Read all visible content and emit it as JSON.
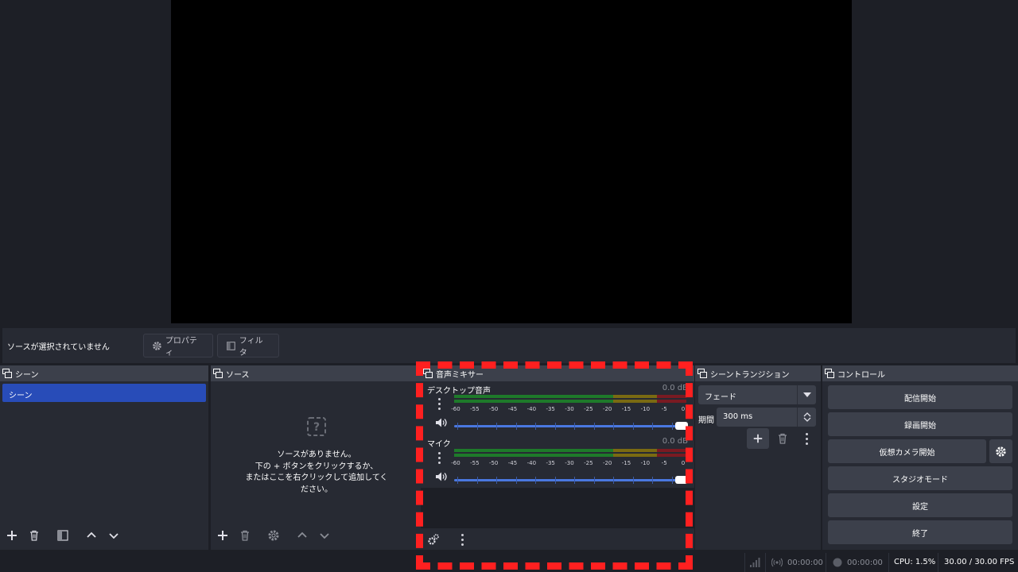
{
  "context": {
    "no_source_text": "ソースが選択されていません",
    "properties_label": "プロパティ",
    "filters_label": "フィルタ"
  },
  "scenes": {
    "title": "シーン",
    "items": [
      "シーン"
    ]
  },
  "sources": {
    "title": "ソース",
    "empty_line1": "ソースがありません。",
    "empty_line2": "下の + ボタンをクリックするか、",
    "empty_line3": "またはここを右クリックして追加してく",
    "empty_line4": "ださい。"
  },
  "mixer": {
    "title": "音声ミキサー",
    "tracks": [
      {
        "name": "デスクトップ音声",
        "db": "0.0 dB"
      },
      {
        "name": "マイク",
        "db": "0.0 dB"
      }
    ],
    "ticks": [
      "-60",
      "-55",
      "-50",
      "-45",
      "-40",
      "-35",
      "-30",
      "-25",
      "-20",
      "-15",
      "-10",
      "-5",
      "0"
    ],
    "colors": {
      "green": "#1e7a2a",
      "yellow": "#7a6a12",
      "red": "#7a1a22",
      "slider": "#4a78e0"
    }
  },
  "transitions": {
    "title": "シーントランジション",
    "selected": "フェード",
    "duration_label": "期間",
    "duration_value": "300 ms"
  },
  "controls": {
    "title": "コントロール",
    "start_streaming": "配信開始",
    "start_recording": "録画開始",
    "start_virtual_cam": "仮想カメラ開始",
    "studio_mode": "スタジオモード",
    "settings": "設定",
    "exit": "終了"
  },
  "status": {
    "stream_time": "00:00:00",
    "record_time": "00:00:00",
    "cpu": "CPU: 1.5%",
    "fps": "30.00 / 30.00 FPS"
  },
  "accent": {
    "selected_scene": "#284cb8",
    "highlight": "#ff2020"
  }
}
